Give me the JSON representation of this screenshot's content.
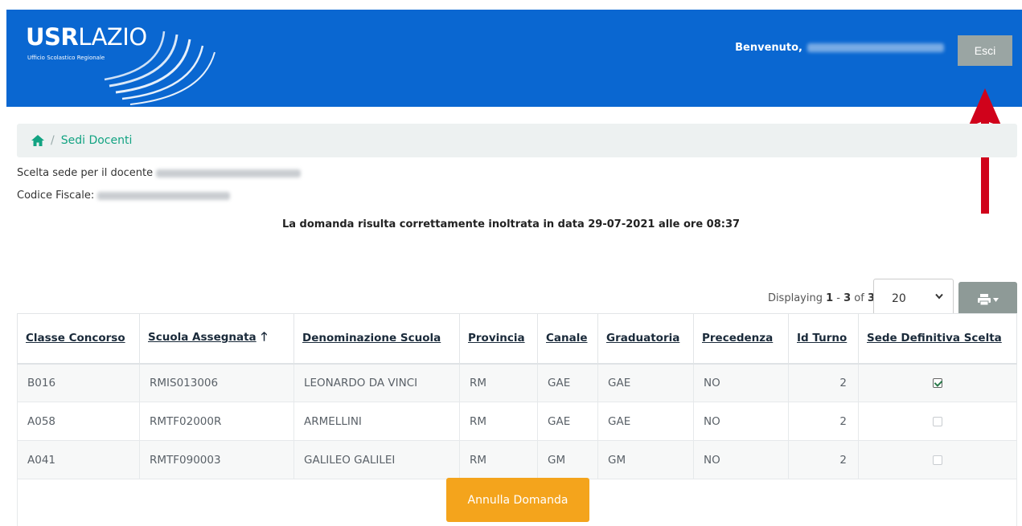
{
  "header": {
    "logo_bold": "USR",
    "logo_light": "LAZIO",
    "logo_sub": "Ufficio Scolastico Regionale",
    "welcome_label": "Benvenuto,",
    "logout_label": "Esci"
  },
  "breadcrumb": {
    "separator": "/",
    "current": "Sedi Docenti"
  },
  "info": {
    "docente_label": "Scelta sede per il docente",
    "codice_label": "Codice Fiscale:"
  },
  "notice": "La domanda risulta correttamente inoltrata in data 29-07-2021 alle ore 08:37",
  "pager": {
    "prefix": "Displaying ",
    "from": "1",
    "dash": " - ",
    "to": "3",
    "of": " of ",
    "total": "3",
    "page_size": "20"
  },
  "table": {
    "columns": [
      "Classe Concorso",
      "Scuola Assegnata",
      "Denominazione Scuola",
      "Provincia",
      "Canale",
      "Graduatoria",
      "Precedenza",
      "Id Turno",
      "Sede Definitiva Scelta"
    ],
    "rows": [
      {
        "classe": "B016",
        "scuola": "RMIS013006",
        "denominazione": "LEONARDO DA VINCI",
        "provincia": "RM",
        "canale": "GAE",
        "graduatoria": "GAE",
        "precedenza": "NO",
        "turno": "2",
        "scelta": true
      },
      {
        "classe": "A058",
        "scuola": "RMTF02000R",
        "denominazione": "ARMELLINI",
        "provincia": "RM",
        "canale": "GAE",
        "graduatoria": "GAE",
        "precedenza": "NO",
        "turno": "2",
        "scelta": false
      },
      {
        "classe": "A041",
        "scuola": "RMTF090003",
        "denominazione": "GALILEO GALILEI",
        "provincia": "RM",
        "canale": "GM",
        "graduatoria": "GM",
        "precedenza": "NO",
        "turno": "2",
        "scelta": false
      }
    ]
  },
  "actions": {
    "annulla_label": "Annulla Domanda"
  },
  "colors": {
    "header_bg": "#0a67d1",
    "accent_green": "#12a382",
    "annulla_bg": "#f4a41c",
    "annotation_red": "#d0021b"
  },
  "icons": {
    "home": "home-icon",
    "sort": "arrow-up-icon",
    "print": "printer-icon",
    "logout_pointer": "red-arrow-annotation"
  }
}
